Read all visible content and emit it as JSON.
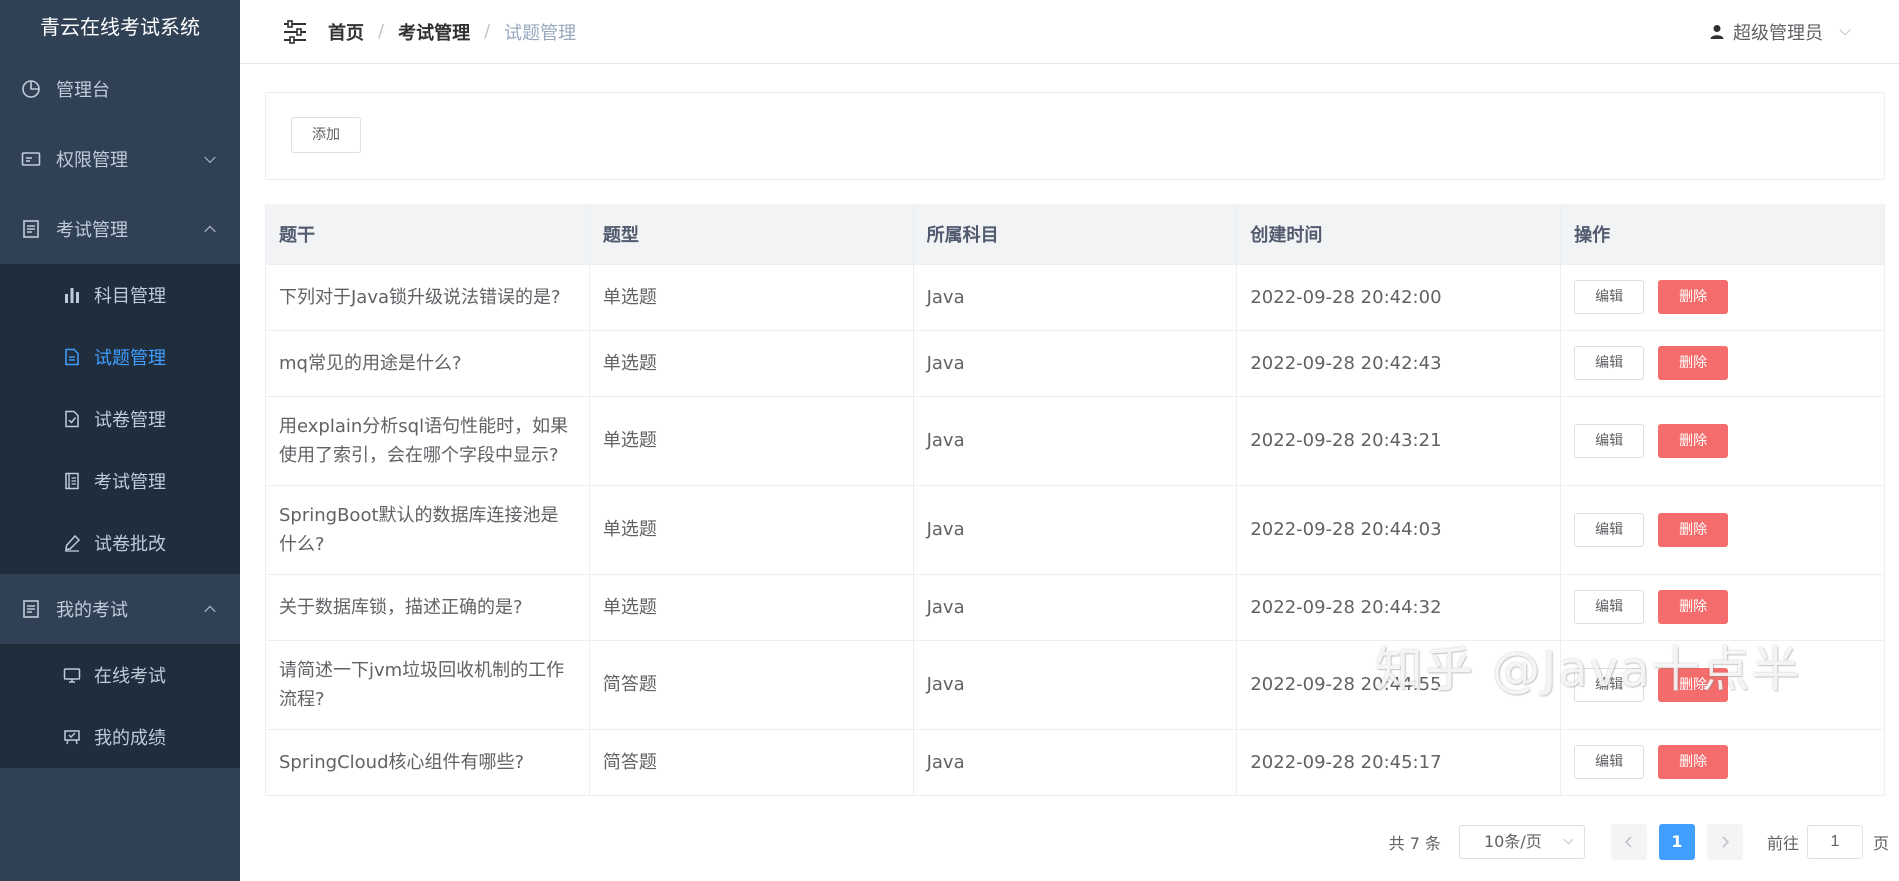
{
  "app_title": "青云在线考试系统",
  "sidebar": {
    "items": [
      {
        "label": "管理台",
        "icon": "pie-chart-icon"
      },
      {
        "label": "权限管理",
        "icon": "id-card-icon",
        "expanded": false
      },
      {
        "label": "考试管理",
        "icon": "document-icon",
        "expanded": true,
        "children": [
          {
            "label": "科目管理",
            "icon": "bar-chart-icon"
          },
          {
            "label": "试题管理",
            "icon": "file-text-icon",
            "active": true
          },
          {
            "label": "试卷管理",
            "icon": "file-check-icon"
          },
          {
            "label": "考试管理",
            "icon": "notebook-icon"
          },
          {
            "label": "试卷批改",
            "icon": "pen-icon"
          }
        ]
      },
      {
        "label": "我的考试",
        "icon": "document-icon",
        "expanded": true,
        "children": [
          {
            "label": "在线考试",
            "icon": "monitor-icon"
          },
          {
            "label": "我的成绩",
            "icon": "trophy-icon"
          }
        ]
      }
    ]
  },
  "header": {
    "breadcrumb": [
      "首页",
      "考试管理",
      "试题管理"
    ],
    "breadcrumb_separator": "/",
    "user": "超级管理员"
  },
  "toolbar": {
    "add_label": "添加"
  },
  "table": {
    "columns": [
      "题干",
      "题型",
      "所属科目",
      "创建时间",
      "操作"
    ],
    "rows": [
      {
        "stem": "下列对于Java锁升级说法错误的是?",
        "type": "单选题",
        "subject": "Java",
        "created": "2022-09-28 20:42:00"
      },
      {
        "stem": "mq常见的用途是什么?",
        "type": "单选题",
        "subject": "Java",
        "created": "2022-09-28 20:42:43"
      },
      {
        "stem": "用explain分析sql语句性能时，如果使用了索引，会在哪个字段中显示?",
        "type": "单选题",
        "subject": "Java",
        "created": "2022-09-28 20:43:21"
      },
      {
        "stem": "SpringBoot默认的数据库连接池是什么?",
        "type": "单选题",
        "subject": "Java",
        "created": "2022-09-28 20:44:03"
      },
      {
        "stem": "关于数据库锁，描述正确的是?",
        "type": "单选题",
        "subject": "Java",
        "created": "2022-09-28 20:44:32"
      },
      {
        "stem": "请简述一下jvm垃圾回收机制的工作流程?",
        "type": "简答题",
        "subject": "Java",
        "created": "2022-09-28 20:44:55"
      },
      {
        "stem": "SpringCloud核心组件有哪些?",
        "type": "简答题",
        "subject": "Java",
        "created": "2022-09-28 20:45:17"
      }
    ],
    "edit_label": "编辑",
    "delete_label": "删除"
  },
  "pagination": {
    "total_text": "共 7 条",
    "page_size": "10条/页",
    "current_page": "1",
    "goto_label": "前往",
    "goto_value": "1",
    "page_suffix": "页"
  },
  "watermark": "知乎 @Java十点半",
  "colors": {
    "sidebar_bg": "#304156",
    "submenu_bg": "#1f2d3d",
    "active": "#409eff",
    "danger": "#f56c6c"
  }
}
